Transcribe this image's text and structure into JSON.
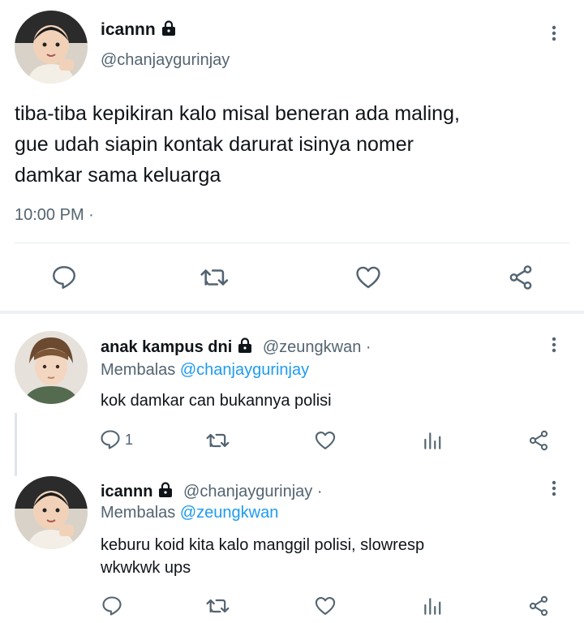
{
  "main_tweet": {
    "display_name": "icannn",
    "handle": "@chanjaygurinjay",
    "text_line1": "tiba-tiba kepikiran kalo misal beneran ada maling,",
    "text_line2": "gue udah siapin kontak darurat isinya nomer",
    "text_line3": "damkar sama keluarga",
    "time": "10:00 PM ·"
  },
  "reply1": {
    "display_name": "anak kampus dni",
    "handle": "@zeungkwan ·",
    "replying_prefix": "Membalas",
    "replying_to": "@chanjaygurinjay",
    "text": "kok damkar can bukannya polisi",
    "reply_count": "1"
  },
  "reply2": {
    "display_name": "icannn",
    "handle": "@chanjaygurinjay ·",
    "replying_prefix": "Membalas",
    "replying_to": "@zeungkwan",
    "text_line1": "keburu koid kita kalo manggil polisi, slowresp",
    "text_line2": "wkwkwk ups"
  },
  "icons": {
    "more": "more-vertical-icon",
    "reply": "reply-icon",
    "retweet": "retweet-icon",
    "like": "heart-icon",
    "share": "share-icon",
    "analytics": "analytics-icon",
    "lock": "lock-icon"
  },
  "colors": {
    "text": "#0f1419",
    "secondary": "#536471",
    "link": "#1d9bf0",
    "divider": "#e6ecf0"
  }
}
